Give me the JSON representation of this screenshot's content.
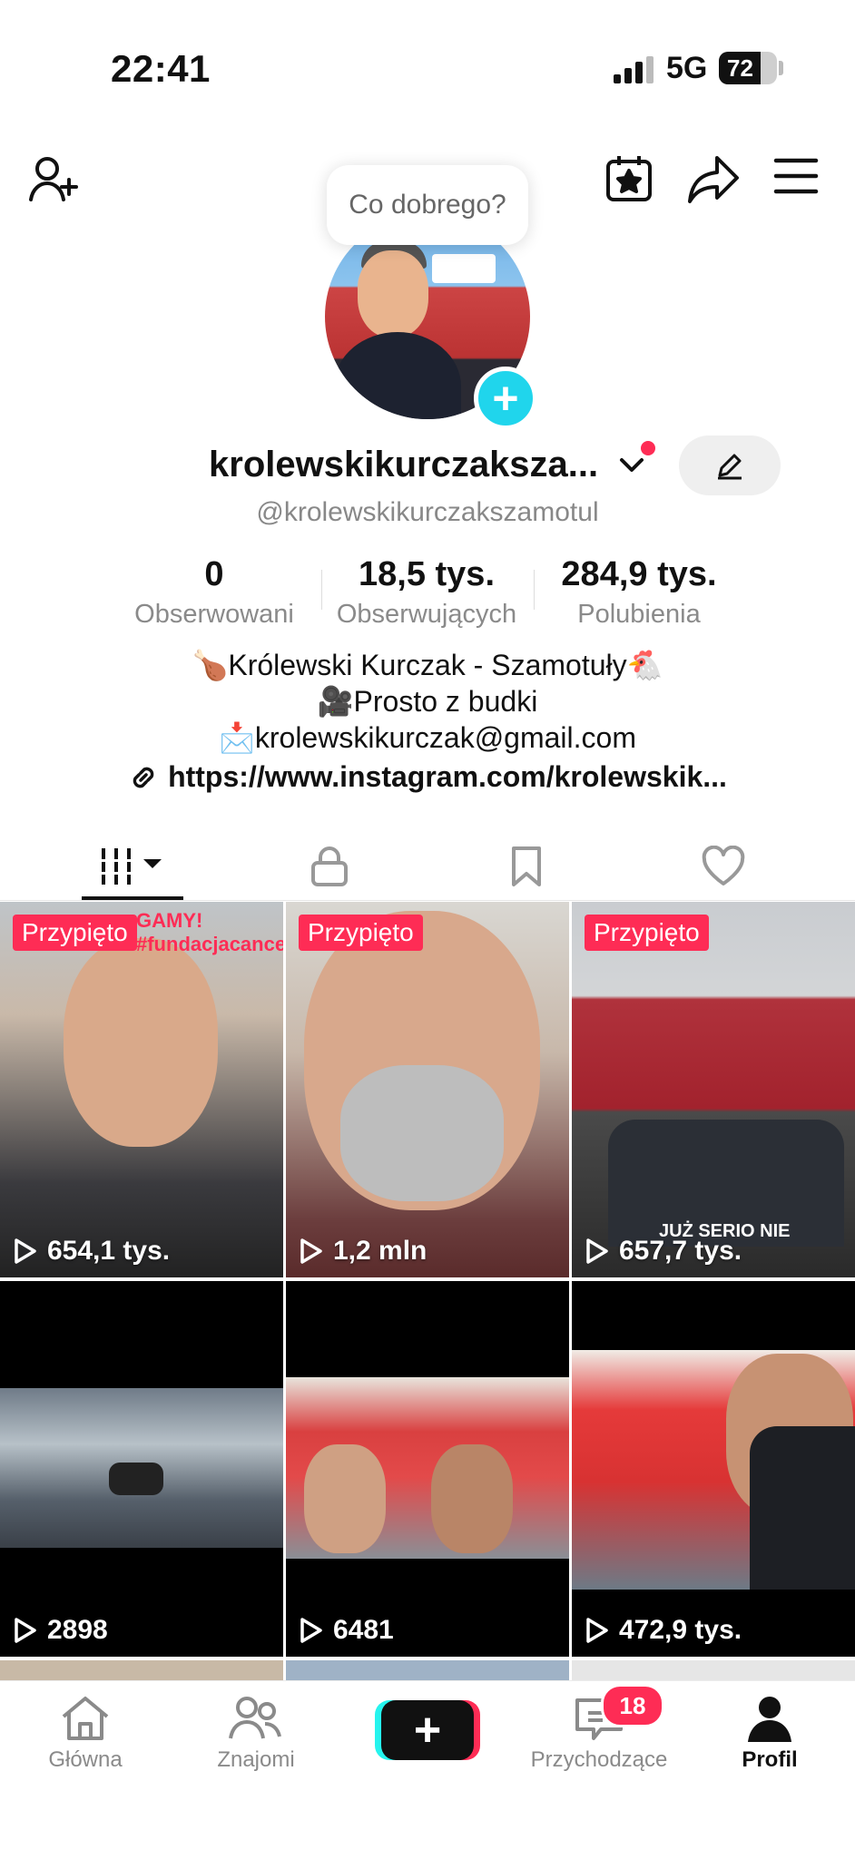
{
  "status_bar": {
    "time": "22:41",
    "network": "5G",
    "battery": "72",
    "battery_level": 0.72
  },
  "tooltip": "Co dobrego?",
  "profile": {
    "name": "krolewskikurczaksza...",
    "handle": "@krolewskikurczakszamotul",
    "stats": [
      {
        "value": "0",
        "label": "Obserwowani"
      },
      {
        "value": "18,5 tys.",
        "label": "Obserwujących"
      },
      {
        "value": "284,9 tys.",
        "label": "Polubienia"
      }
    ],
    "bio": [
      "🍗Królewski Kurczak - Szamotuły🐔",
      "🎥Prosto z budki",
      "📩krolewskikurczak@gmail.com"
    ],
    "link": "https://www.instagram.com/krolewskik..."
  },
  "tabs": [
    "videos-icon",
    "lock-icon",
    "bookmark-icon",
    "heart-icon"
  ],
  "videos": [
    {
      "pinned": "Przypięto",
      "views": "654,1 tys.",
      "overlay": "GAMY! #fundacjacancerfighter"
    },
    {
      "pinned": "Przypięto",
      "views": "1,2 mln",
      "overlay": ""
    },
    {
      "pinned": "Przypięto",
      "views": "657,7 tys.",
      "overlay": "JUŻ SERIO NIE"
    },
    {
      "pinned": "",
      "views": "2898",
      "overlay": ""
    },
    {
      "pinned": "",
      "views": "6481",
      "overlay": ""
    },
    {
      "pinned": "",
      "views": "472,9 tys.",
      "overlay": ""
    }
  ],
  "nav": {
    "home": "Główna",
    "friends": "Znajomi",
    "inbox": "Przychodzące",
    "inbox_badge": "18",
    "profile": "Profil"
  },
  "colors": {
    "accent": "#fe2c55",
    "cyan": "#25f4ee",
    "avatar_plus": "#20d5ec"
  }
}
